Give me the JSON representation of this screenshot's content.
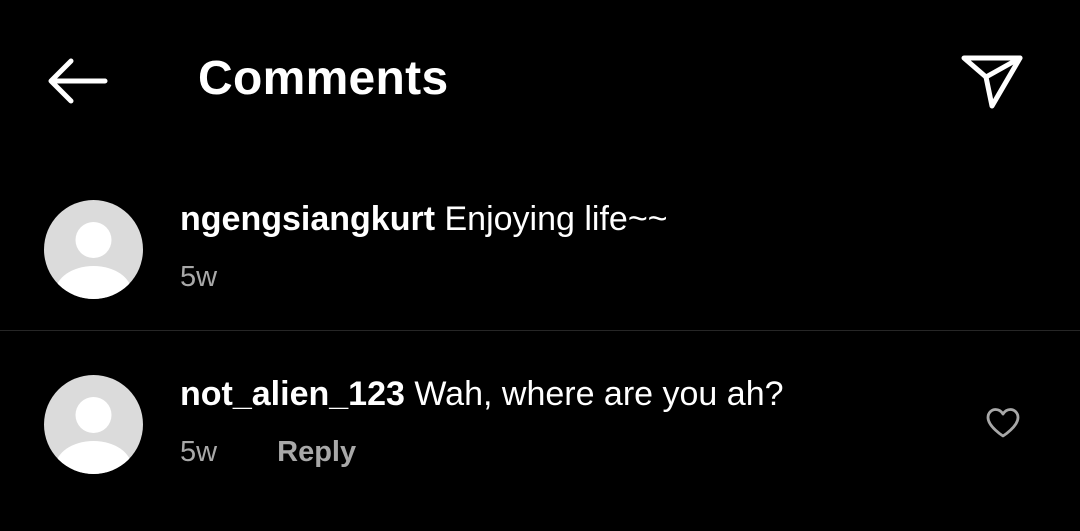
{
  "header": {
    "title": "Comments",
    "back_icon": "arrow-left-icon",
    "share_icon": "paper-plane-icon"
  },
  "comments": [
    {
      "username": "ngengsiangkurt",
      "text": "Enjoying life~~",
      "time": "5w",
      "avatar_icon": "default-avatar-icon"
    },
    {
      "username": "not_alien_123",
      "text": "Wah, where are you ah?",
      "time": "5w",
      "reply_label": "Reply",
      "avatar_icon": "default-avatar-icon",
      "like_icon": "heart-outline-icon"
    }
  ],
  "colors": {
    "background": "#000000",
    "text": "#ffffff",
    "secondary_text": "#a8a8a8",
    "avatar_bg": "#dbdbdb",
    "divider": "#262626"
  }
}
